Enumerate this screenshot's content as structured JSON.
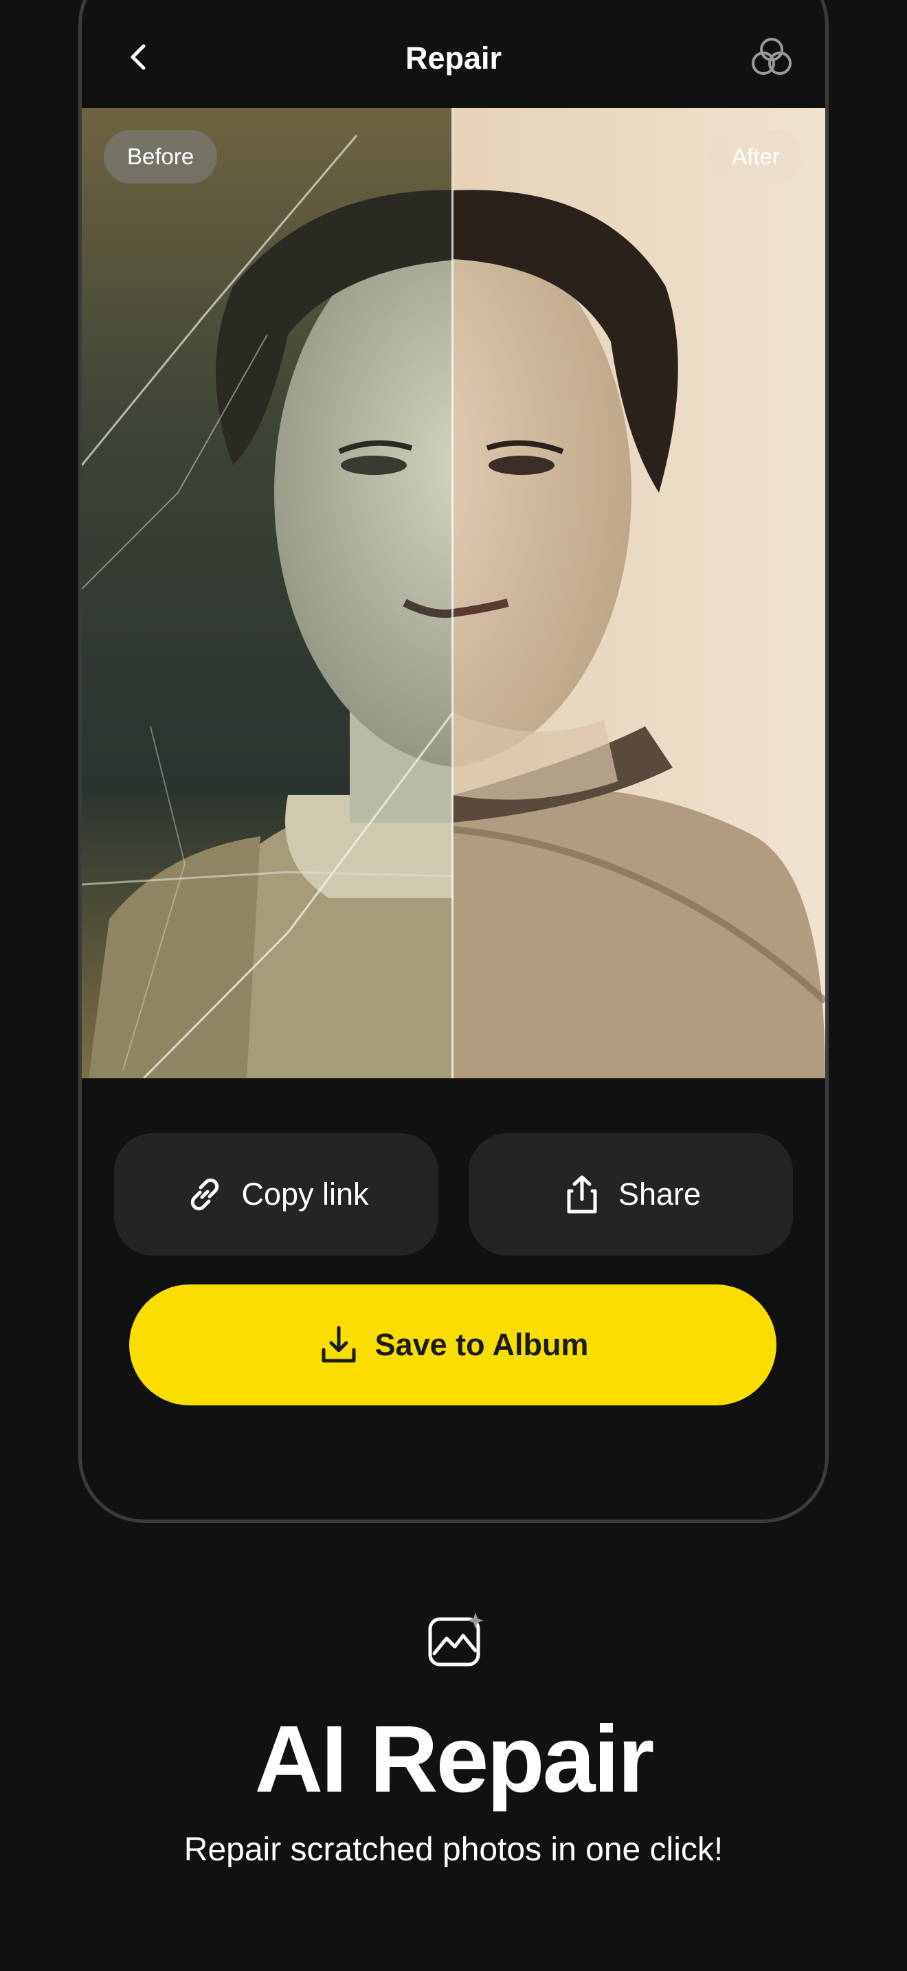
{
  "nav": {
    "title": "Repair"
  },
  "compare": {
    "before_label": "Before",
    "after_label": "After"
  },
  "actions": {
    "copy_link_label": "Copy link",
    "share_label": "Share",
    "save_label": "Save to Album"
  },
  "feature": {
    "title": "AI Repair",
    "subtitle": "Repair scratched photos in one click!"
  },
  "colors": {
    "background": "#111111",
    "accent": "#fade00",
    "secondary_button": "#242424",
    "text": "#ffffff"
  },
  "icons": {
    "back": "chevron-left-icon",
    "filters": "overlapping-circles-icon",
    "copy_link": "link-icon",
    "share": "share-icon",
    "save": "download-icon",
    "feature": "image-sparkle-icon"
  }
}
